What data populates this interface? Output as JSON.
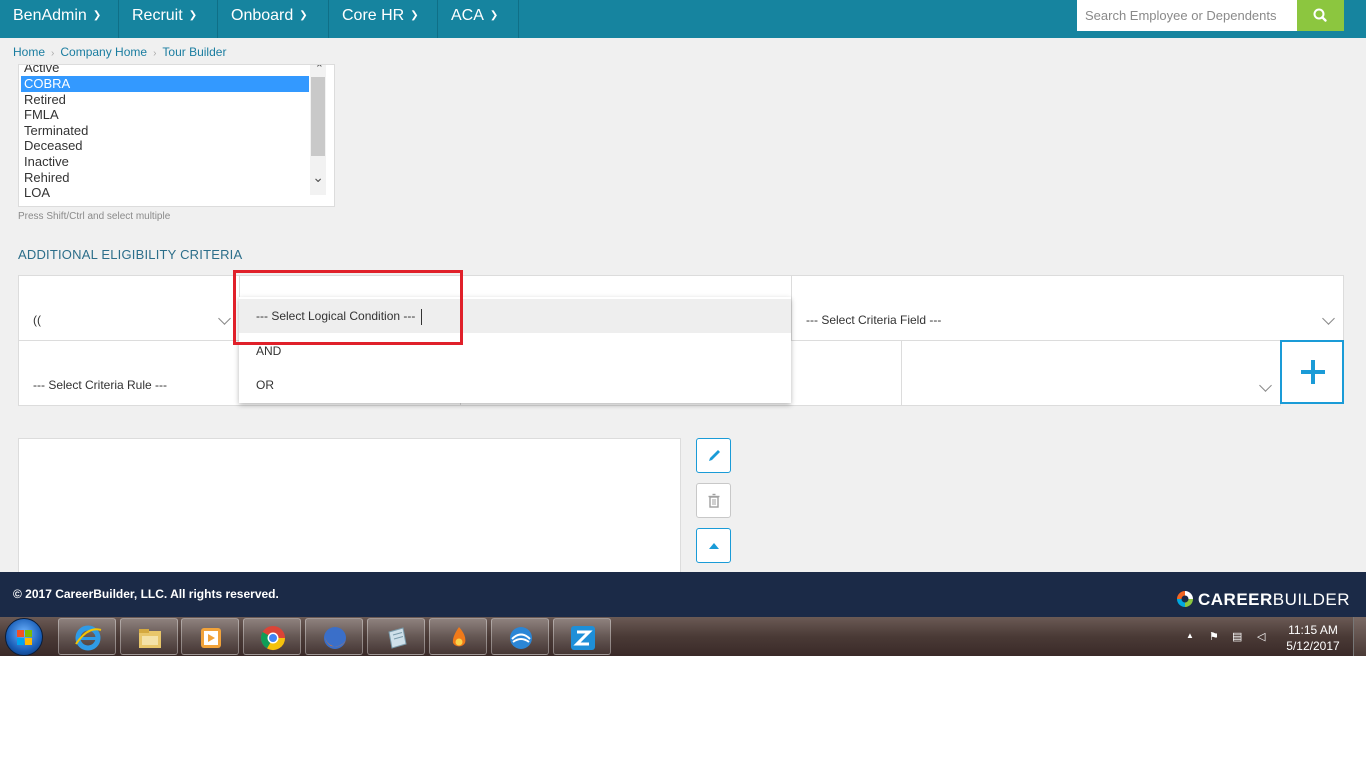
{
  "nav": {
    "items": [
      {
        "label": "BenAdmin"
      },
      {
        "label": "Recruit"
      },
      {
        "label": "Onboard"
      },
      {
        "label": "Core HR"
      },
      {
        "label": "ACA"
      }
    ],
    "search_placeholder": "Search Employee or Dependents"
  },
  "breadcrumb": [
    "Home",
    "Company Home",
    "Tour Builder"
  ],
  "status_list": {
    "options": [
      "Active",
      "COBRA",
      "Retired",
      "FMLA",
      "Terminated",
      "Deceased",
      "Inactive",
      "Rehired",
      "LOA"
    ],
    "selected": "COBRA",
    "hint": "Press Shift/Ctrl and select multiple"
  },
  "criteria": {
    "section_title": "ADDITIONAL ELIGIBILITY CRITERIA",
    "paren_value": "((",
    "criteria_field": "--- Select Criteria Field ---",
    "criteria_rule": "--- Select Criteria Rule ---",
    "logical_dropdown": {
      "options": [
        "--- Select Logical Condition ---",
        "AND",
        "OR"
      ],
      "highlighted": "--- Select Logical Condition ---"
    }
  },
  "footer": {
    "copyright": "© 2017 CareerBuilder, LLC. All rights reserved.",
    "brand_bold": "CAREER",
    "brand_light": "BUILDER"
  },
  "taskbar": {
    "time": "11:15 AM",
    "date": "5/12/2017"
  },
  "colors": {
    "nav_bg": "#16849f",
    "search_button": "#8cc63f",
    "accent": "#1a9bd7",
    "footer_bg": "#1b2a47",
    "highlight_box": "#e0202a"
  }
}
